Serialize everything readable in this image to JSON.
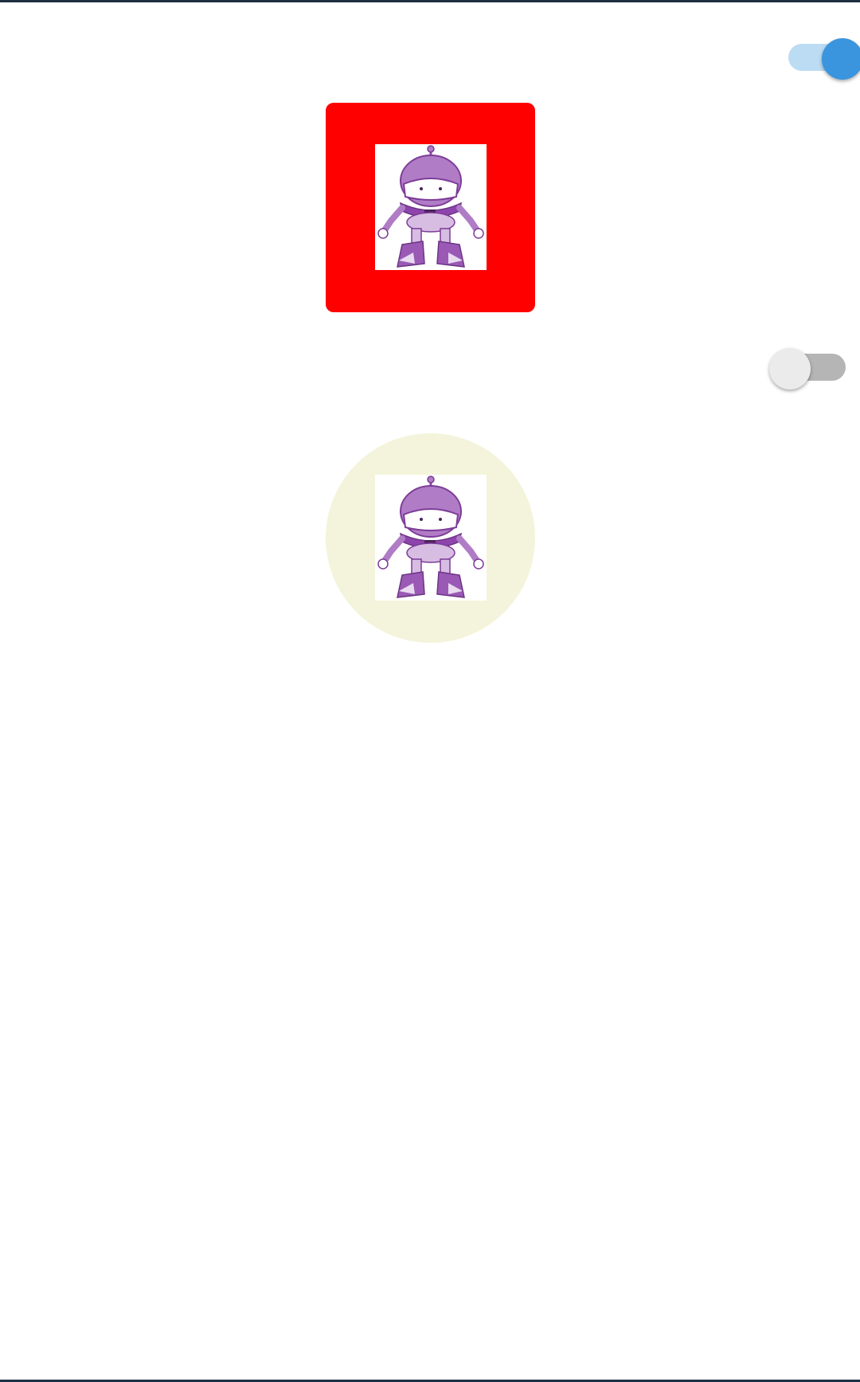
{
  "switches": [
    {
      "name": "border-style-switch",
      "state": "on",
      "track_color": "#bcdcf4",
      "thumb_color": "#3a95de"
    },
    {
      "name": "shape-style-switch",
      "state": "off",
      "track_color": "#b5b5b5",
      "thumb_color": "#ebebeb"
    }
  ],
  "frames": [
    {
      "shape": "rounded-square",
      "color": "#ff0000",
      "image": "robot-mascot"
    },
    {
      "shape": "circle",
      "color": "#f4f4dc",
      "image": "robot-mascot"
    }
  ],
  "colors": {
    "header_bar": "#1d2f42",
    "robot_primary": "#9b59b6",
    "robot_light": "#c9a6dd"
  }
}
